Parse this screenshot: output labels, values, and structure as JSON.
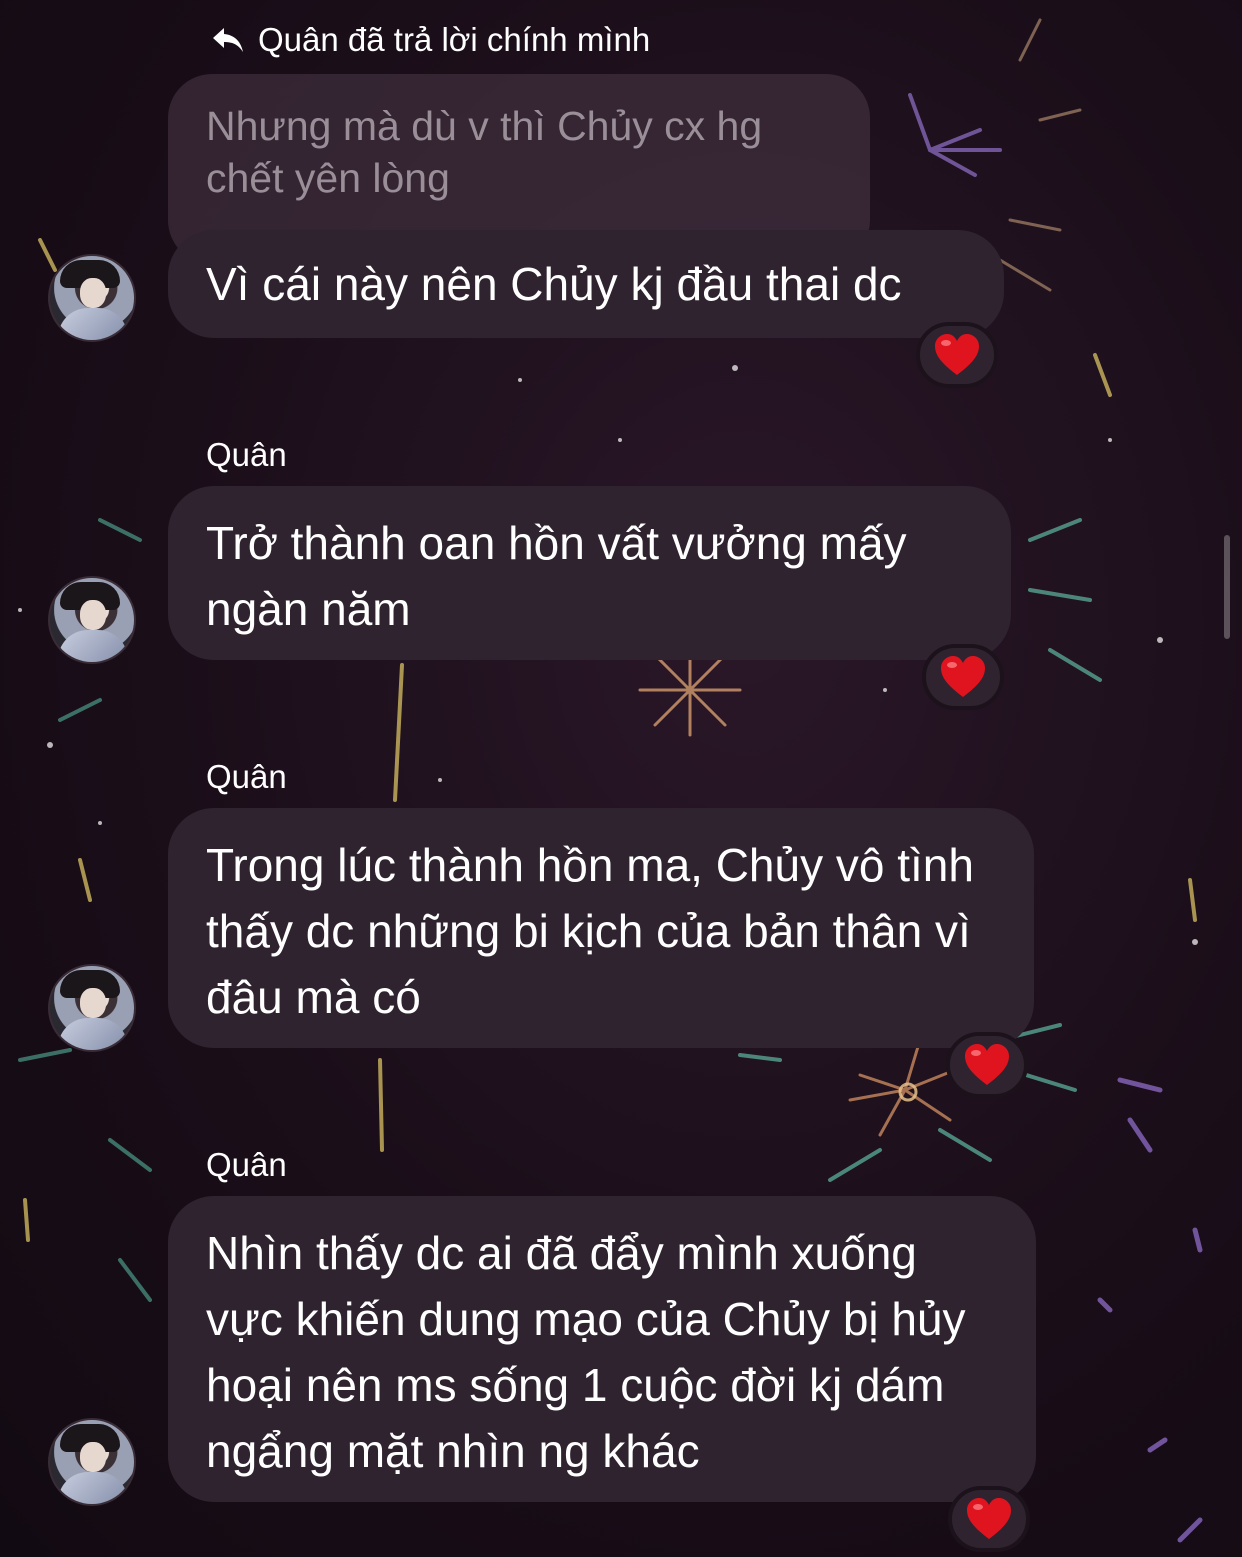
{
  "reply_header": {
    "text": "Quân đã trả lời chính mình"
  },
  "quoted_message": {
    "text": "Nhưng mà dù v thì Chủy cx hg chết yên lòng"
  },
  "messages": [
    {
      "sender": "",
      "text": "Vì cái này nên Chủy kj đầu thai dc",
      "reaction": "heart"
    },
    {
      "sender": "Quân",
      "text": "Trở thành oan hồn vất vưởng mấy ngàn năm",
      "reaction": "heart"
    },
    {
      "sender": "Quân",
      "text": "Trong lúc thành hồn ma, Chủy vô tình thấy dc những bi kịch của bản thân vì đâu mà có",
      "reaction": "heart"
    },
    {
      "sender": "Quân",
      "text": "Nhìn thấy dc ai đã đẩy mình xuống vực khiến dung mạo của Chủy bị hủy hoại nên ms sống 1 cuộc đời kj dám ngẩng mặt nhìn ng khác",
      "reaction": "heart"
    }
  ],
  "colors": {
    "background": "#1a0f1a",
    "bubble": "#2f2330",
    "quoted_bubble": "#463442",
    "quoted_text": "#9a8e98",
    "text": "#ffffff",
    "heart": "#e0141e"
  }
}
